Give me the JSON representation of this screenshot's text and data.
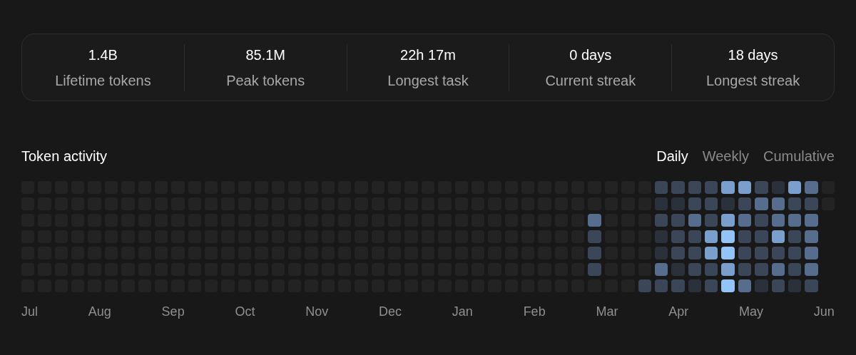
{
  "stats": [
    {
      "value": "1.4B",
      "label": "Lifetime tokens"
    },
    {
      "value": "85.1M",
      "label": "Peak tokens"
    },
    {
      "value": "22h 17m",
      "label": "Longest task"
    },
    {
      "value": "0 days",
      "label": "Current streak"
    },
    {
      "value": "18 days",
      "label": "Longest streak"
    }
  ],
  "activity": {
    "title": "Token activity",
    "views": [
      {
        "label": "Daily",
        "selected": true
      },
      {
        "label": "Weekly",
        "selected": false
      },
      {
        "label": "Cumulative",
        "selected": false
      }
    ],
    "months": [
      "Jul",
      "Aug",
      "Sep",
      "Oct",
      "Nov",
      "Dec",
      "Jan",
      "Feb",
      "Mar",
      "Apr",
      "May",
      "Jun"
    ]
  }
}
